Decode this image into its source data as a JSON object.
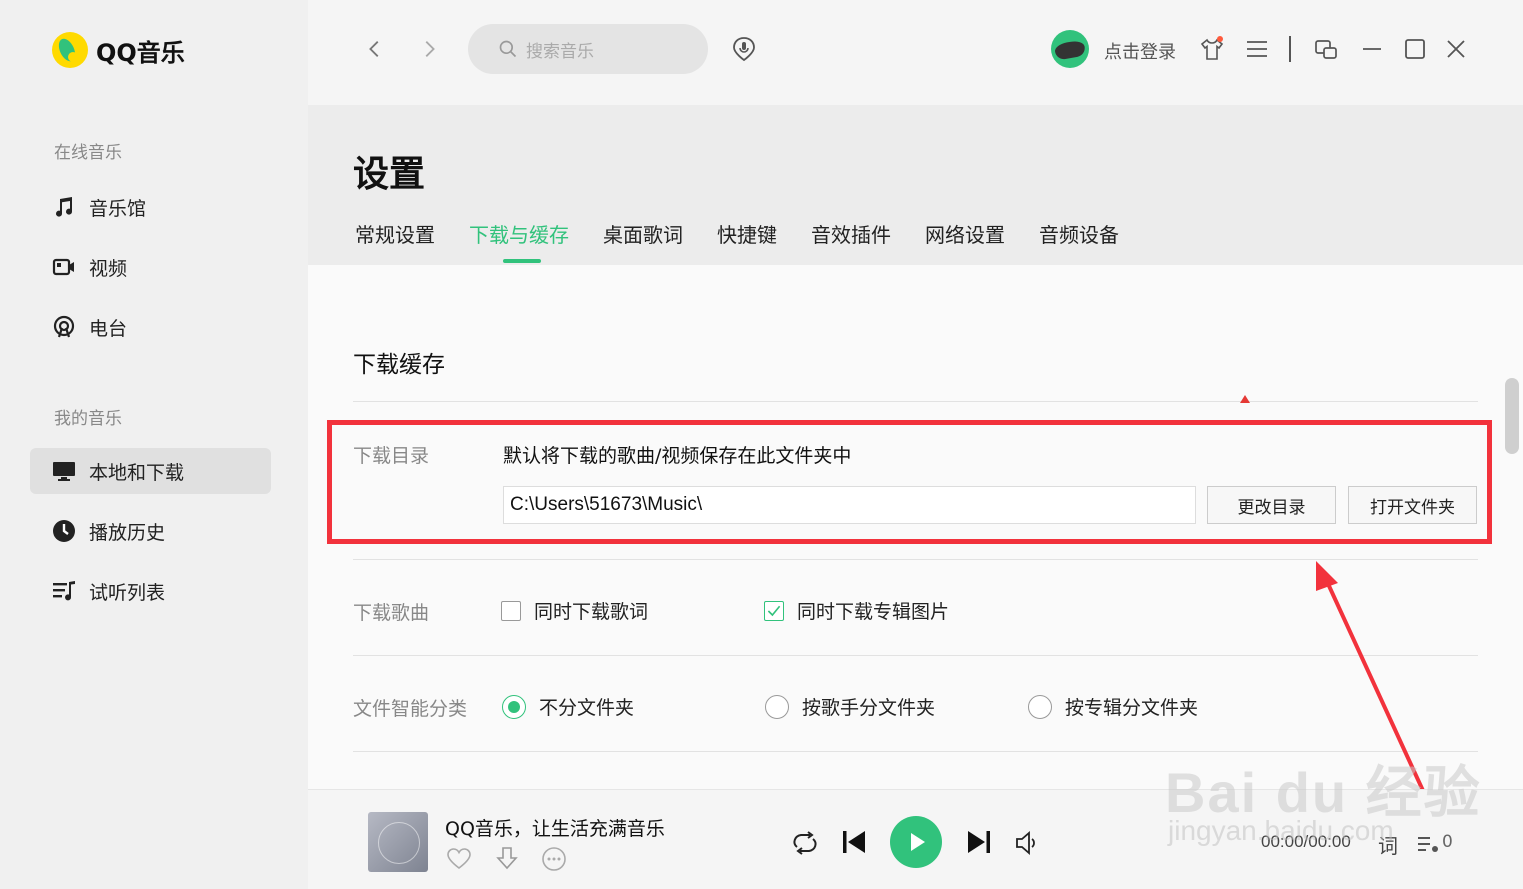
{
  "app": {
    "name": "QQ音乐"
  },
  "sidebar": {
    "section_online": "在线音乐",
    "online_items": [
      {
        "label": "音乐馆",
        "icon": "music-note-icon"
      },
      {
        "label": "视频",
        "icon": "video-icon"
      },
      {
        "label": "电台",
        "icon": "radio-icon"
      }
    ],
    "section_mine": "我的音乐",
    "mine_items": [
      {
        "label": "本地和下载",
        "icon": "monitor-icon",
        "active": true
      },
      {
        "label": "播放历史",
        "icon": "clock-icon"
      },
      {
        "label": "试听列表",
        "icon": "playlist-icon"
      }
    ]
  },
  "topbar": {
    "search_placeholder": "搜索音乐",
    "login_label": "点击登录"
  },
  "settings": {
    "title": "设置",
    "tabs": [
      "常规设置",
      "下载与缓存",
      "桌面歌词",
      "快捷键",
      "音效插件",
      "网络设置",
      "音频设备"
    ],
    "active_tab": "下载与缓存",
    "section_title": "下载缓存",
    "download_dir": {
      "label": "下载目录",
      "description": "默认将下载的歌曲/视频保存在此文件夹中",
      "path": "C:\\Users\\51673\\Music\\",
      "change_button": "更改目录",
      "open_button": "打开文件夹"
    },
    "download_songs": {
      "label": "下载歌曲",
      "option_lyrics": "同时下载歌词",
      "option_lyrics_checked": false,
      "option_cover": "同时下载专辑图片",
      "option_cover_checked": true
    },
    "smart_classify": {
      "label": "文件智能分类",
      "options": [
        "不分文件夹",
        "按歌手分文件夹",
        "按专辑分文件夹"
      ],
      "selected": "不分文件夹"
    }
  },
  "player": {
    "song_title": "QQ音乐，让生活充满音乐",
    "time": "00:00/00:00",
    "lyric_label": "词",
    "playlist_count": "0"
  },
  "watermark": {
    "main": "Bai du 经验",
    "sub": "jingyan.baidu.com"
  },
  "colors": {
    "accent": "#31c27c",
    "highlight": "#f2323c"
  }
}
